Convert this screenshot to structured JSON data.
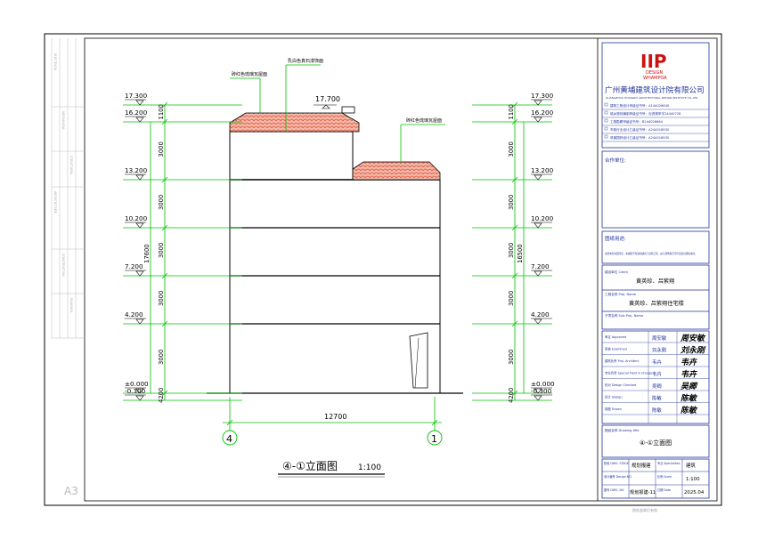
{
  "sheet": {
    "size_label": "A3",
    "bottom_note": "图纸盖章后有效"
  },
  "left_strip": {
    "labels": [
      "ELECTRICAL",
      "MECHANICAL",
      "STRUCTURAL",
      "ARCHITECTURE",
      "CONSTRUCTION",
      "PLANNING",
      "ELECTRICAL",
      "MECHANICAL"
    ]
  },
  "elevation": {
    "levels": [
      {
        "label": "17.300"
      },
      {
        "label": "16.200"
      },
      {
        "label": "13.200"
      },
      {
        "label": "10.200"
      },
      {
        "label": "7.200"
      },
      {
        "label": "4.200"
      },
      {
        "label": "±0.000"
      },
      {
        "label": "-0.300"
      }
    ],
    "top_level": "17.700",
    "segment_dims": [
      "1100",
      "3000",
      "3000",
      "3000",
      "3000",
      "3000",
      "4200",
      "300"
    ],
    "total_left": "17600",
    "total_right": "16500",
    "width_dim": "12700",
    "axis_left": "4",
    "axis_right": "1",
    "annotations": {
      "roof_top": "砖红色琉璃瓦屋面",
      "wall": "乳白色真石漆饰面",
      "roof_side": "砖红色琉璃瓦屋面"
    },
    "title": "④-①立面图",
    "scale": "1:100"
  },
  "title_block": {
    "logo_mark": "IIP",
    "logo_line1": "DESIGN",
    "logo_line2": "WHAMPOA",
    "company_cn": "广州黄埔建筑设计院有限公司",
    "company_en": "GUANGZHOU HUANGPU ARCHITECTURAL DESIGN INSTITUTE CO.,LTD",
    "certs": [
      "建筑工程设计甲级证书号：A144026640",
      "城乡规划编制甲级证书号：自资规甲字24440728",
      "工程勘察甲级证书号：B244026664",
      "市政行业设计乙级证书号：A244018930",
      "风景园林设计乙级证书号：A244018930"
    ],
    "coop_label": "合作单位:",
    "stamp_label": "图纸用途:",
    "stamp_note": "未经本院书面同意，本图纸不得复制或用于其他工程。如与现场情况不符请及时通知本院。",
    "client_label": "建设单位 Client",
    "client_value": "黄英珍、吕紫翔",
    "project_label": "工程名称  Proj. Name",
    "project_value": "黄英珍、吕紫翔住宅楼",
    "subproj_label": "子项名称  Sub-Proj. Name",
    "subproj_value": "",
    "staff": [
      {
        "role": "审定 Approved",
        "name": "周安敏",
        "sig": "周安敏"
      },
      {
        "role": "审核 Examined",
        "name": "刘永刚",
        "sig": "刘永刚"
      },
      {
        "role": "建筑负责 Proj. Architect",
        "name": "韦卉",
        "sig": "韦卉"
      },
      {
        "role": "专业负责 Special Field in Charge",
        "name": "韦卉",
        "sig": "韦卉"
      },
      {
        "role": "校对 Design Checked",
        "name": "吴卿",
        "sig": "吴卿"
      },
      {
        "role": "设计 Design",
        "name": "陈敏",
        "sig": "陈敏"
      },
      {
        "role": "制图 Drawn",
        "name": "陈敏",
        "sig": "陈敏"
      }
    ],
    "drawing_title_label": "图纸名称  Drawing title",
    "drawing_title": "④-①立面图",
    "bottom": {
      "stage_label": "阶段 DWG. STAGE",
      "stage_value": "规划报建",
      "spec_label": "专业 Specialities",
      "spec_value": "建筑",
      "dwgno_label": "设计编号 Design NO.",
      "dwgno_value": "",
      "scale_label": "比例 Scale",
      "scale_value": "1:100",
      "sheet_label": "图号 DWG. NO.",
      "sheet_value": "规划报建-11",
      "date_label": "日期 Date",
      "date_value": "2025.04"
    }
  },
  "colors": {
    "frame": "#000000",
    "building_line": "#000000",
    "dim_line": "#00c000",
    "roof_tile": "#e2553a",
    "tb_blue": "#223399",
    "faint": "#c8c8c8"
  }
}
